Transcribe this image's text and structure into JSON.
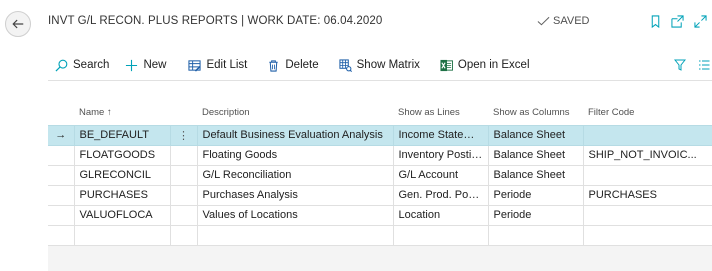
{
  "header": {
    "title": "INVT G/L RECON. PLUS REPORTS | WORK DATE: 06.04.2020",
    "saved_label": "SAVED"
  },
  "toolbar": {
    "search_label": "Search",
    "new_label": "New",
    "edit_list_label": "Edit List",
    "delete_label": "Delete",
    "show_matrix_label": "Show Matrix",
    "open_excel_label": "Open in Excel"
  },
  "table": {
    "columns": {
      "name": "Name",
      "name_sort": "↑",
      "description": "Description",
      "show_as_lines": "Show as Lines",
      "show_as_columns": "Show as Columns",
      "filter_code": "Filter Code"
    },
    "selected_indicator": "→",
    "row_menu_glyph": "⋮",
    "rows": [
      {
        "name": "BE_DEFAULT",
        "description": "Default Business Evaluation Analysis",
        "lines": "Income Stateme...",
        "columns": "Balance Sheet",
        "filter": ""
      },
      {
        "name": "FLOATGOODS",
        "description": "Floating Goods",
        "lines": "Inventory Postin...",
        "columns": "Balance Sheet",
        "filter": "SHIP_NOT_INVOIC..."
      },
      {
        "name": "GLRECONCIL",
        "description": "G/L Reconciliation",
        "lines": "G/L Account",
        "columns": "Balance Sheet",
        "filter": ""
      },
      {
        "name": "PURCHASES",
        "description": "Purchases Analysis",
        "lines": "Gen. Prod. Posti...",
        "columns": "Periode",
        "filter": "PURCHASES"
      },
      {
        "name": "VALUOFLOCA",
        "description": "Values of Locations",
        "lines": "Location",
        "columns": "Periode",
        "filter": ""
      }
    ]
  },
  "colors": {
    "selected_row": "#c4e6ee",
    "accent": "#00a2b8",
    "excel_green": "#1e7145"
  }
}
